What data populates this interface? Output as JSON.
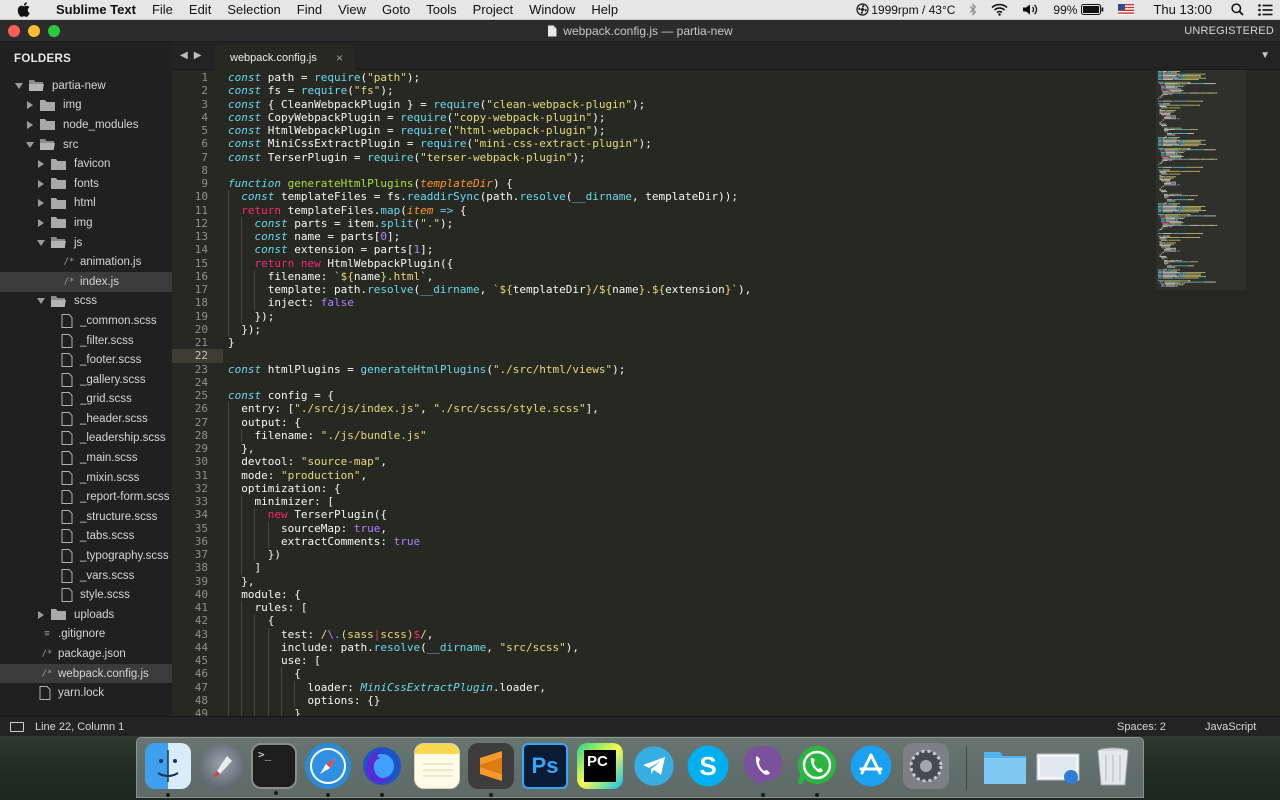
{
  "menubar": {
    "app": "Sublime Text",
    "items": [
      "File",
      "Edit",
      "Selection",
      "Find",
      "View",
      "Goto",
      "Tools",
      "Project",
      "Window",
      "Help"
    ],
    "status": "1999rpm / 43°C",
    "battery": "99%",
    "clock": "Thu 13:00"
  },
  "window": {
    "title": "webpack.config.js — partia-new",
    "unregistered": "UNREGISTERED"
  },
  "sidebar": {
    "header": "FOLDERS",
    "rows": [
      {
        "label": "partia-new",
        "kind": "folder",
        "depth": 0,
        "open": true
      },
      {
        "label": "img",
        "kind": "folder",
        "depth": 1,
        "open": false
      },
      {
        "label": "node_modules",
        "kind": "folder",
        "depth": 1,
        "open": false
      },
      {
        "label": "src",
        "kind": "folder",
        "depth": 1,
        "open": true
      },
      {
        "label": "favicon",
        "kind": "folder",
        "depth": 2,
        "open": false
      },
      {
        "label": "fonts",
        "kind": "folder",
        "depth": 2,
        "open": false
      },
      {
        "label": "html",
        "kind": "folder",
        "depth": 2,
        "open": false
      },
      {
        "label": "img",
        "kind": "folder",
        "depth": 2,
        "open": false
      },
      {
        "label": "js",
        "kind": "folder",
        "depth": 2,
        "open": true
      },
      {
        "label": "animation.js",
        "kind": "script",
        "depth": 3
      },
      {
        "label": "index.js",
        "kind": "script",
        "depth": 3,
        "selected": true
      },
      {
        "label": "scss",
        "kind": "folder",
        "depth": 2,
        "open": true
      },
      {
        "label": "_common.scss",
        "kind": "file",
        "depth": 3
      },
      {
        "label": "_filter.scss",
        "kind": "file",
        "depth": 3
      },
      {
        "label": "_footer.scss",
        "kind": "file",
        "depth": 3
      },
      {
        "label": "_gallery.scss",
        "kind": "file",
        "depth": 3
      },
      {
        "label": "_grid.scss",
        "kind": "file",
        "depth": 3
      },
      {
        "label": "_header.scss",
        "kind": "file",
        "depth": 3
      },
      {
        "label": "_leadership.scss",
        "kind": "file",
        "depth": 3
      },
      {
        "label": "_main.scss",
        "kind": "file",
        "depth": 3
      },
      {
        "label": "_mixin.scss",
        "kind": "file",
        "depth": 3
      },
      {
        "label": "_report-form.scss",
        "kind": "file",
        "depth": 3
      },
      {
        "label": "_structure.scss",
        "kind": "file",
        "depth": 3
      },
      {
        "label": "_tabs.scss",
        "kind": "file",
        "depth": 3
      },
      {
        "label": "_typography.scss",
        "kind": "file",
        "depth": 3
      },
      {
        "label": "_vars.scss",
        "kind": "file",
        "depth": 3
      },
      {
        "label": "style.scss",
        "kind": "file",
        "depth": 3
      },
      {
        "label": "uploads",
        "kind": "folder",
        "depth": 2,
        "open": false
      },
      {
        "label": ".gitignore",
        "kind": "text",
        "depth": 1
      },
      {
        "label": "package.json",
        "kind": "script",
        "depth": 1
      },
      {
        "label": "webpack.config.js",
        "kind": "script",
        "depth": 1,
        "selected": true
      },
      {
        "label": "yarn.lock",
        "kind": "file",
        "depth": 1
      }
    ]
  },
  "tab": {
    "label": "webpack.config.js",
    "close": "×"
  },
  "editor": {
    "current_line": 22,
    "colors": {
      "keyword": "#f92672",
      "storage": "#66d9ef",
      "string": "#e6db74",
      "function": "#a6e22e",
      "param": "#fd971f",
      "constant": "#ae81ff",
      "plain": "#f8f8f2"
    },
    "lines": [
      [
        [
          "const",
          "st"
        ],
        [
          " path = ",
          "p"
        ],
        [
          "require",
          "f"
        ],
        [
          "(",
          "p"
        ],
        [
          "\"path\"",
          "s"
        ],
        [
          ");",
          "p"
        ]
      ],
      [
        [
          "const",
          "st"
        ],
        [
          " fs = ",
          "p"
        ],
        [
          "require",
          "f"
        ],
        [
          "(",
          "p"
        ],
        [
          "\"fs\"",
          "s"
        ],
        [
          ");",
          "p"
        ]
      ],
      [
        [
          "const",
          "st"
        ],
        [
          " { CleanWebpackPlugin } = ",
          "p"
        ],
        [
          "require",
          "f"
        ],
        [
          "(",
          "p"
        ],
        [
          "\"clean-webpack-plugin\"",
          "s"
        ],
        [
          ");",
          "p"
        ]
      ],
      [
        [
          "const",
          "st"
        ],
        [
          " CopyWebpackPlugin = ",
          "p"
        ],
        [
          "require",
          "f"
        ],
        [
          "(",
          "p"
        ],
        [
          "\"copy-webpack-plugin\"",
          "s"
        ],
        [
          ");",
          "p"
        ]
      ],
      [
        [
          "const",
          "st"
        ],
        [
          " HtmlWebpackPlugin = ",
          "p"
        ],
        [
          "require",
          "f"
        ],
        [
          "(",
          "p"
        ],
        [
          "\"html-webpack-plugin\"",
          "s"
        ],
        [
          ");",
          "p"
        ]
      ],
      [
        [
          "const",
          "st"
        ],
        [
          " MiniCssExtractPlugin = ",
          "p"
        ],
        [
          "require",
          "f"
        ],
        [
          "(",
          "p"
        ],
        [
          "\"mini-css-extract-plugin\"",
          "s"
        ],
        [
          ");",
          "p"
        ]
      ],
      [
        [
          "const",
          "st"
        ],
        [
          " TerserPlugin = ",
          "p"
        ],
        [
          "require",
          "f"
        ],
        [
          "(",
          "p"
        ],
        [
          "\"terser-webpack-plugin\"",
          "s"
        ],
        [
          ");",
          "p"
        ]
      ],
      [],
      [
        [
          "function",
          "st"
        ],
        [
          " ",
          "p"
        ],
        [
          "generateHtmlPlugins",
          "fn"
        ],
        [
          "(",
          "p"
        ],
        [
          "templateDir",
          "pa"
        ],
        [
          ") {",
          "p"
        ]
      ],
      [
        [
          "  ",
          "p"
        ],
        [
          "const",
          "st"
        ],
        [
          " templateFiles = fs.",
          "p"
        ],
        [
          "readdirSync",
          "f"
        ],
        [
          "(path.",
          "p"
        ],
        [
          "resolve",
          "f"
        ],
        [
          "(",
          "p"
        ],
        [
          "__dirname",
          "f"
        ],
        [
          ", templateDir));",
          "p"
        ]
      ],
      [
        [
          "  ",
          "p"
        ],
        [
          "return",
          "k"
        ],
        [
          " templateFiles.",
          "p"
        ],
        [
          "map",
          "f"
        ],
        [
          "(",
          "p"
        ],
        [
          "item",
          "pa"
        ],
        [
          " ",
          "p"
        ],
        [
          "=>",
          "st"
        ],
        [
          " {",
          "p"
        ]
      ],
      [
        [
          "    ",
          "p"
        ],
        [
          "const",
          "st"
        ],
        [
          " parts = item.",
          "p"
        ],
        [
          "split",
          "f"
        ],
        [
          "(",
          "p"
        ],
        [
          "\".\"",
          "s"
        ],
        [
          ");",
          "p"
        ]
      ],
      [
        [
          "    ",
          "p"
        ],
        [
          "const",
          "st"
        ],
        [
          " name = parts[",
          "p"
        ],
        [
          "0",
          "c"
        ],
        [
          "];",
          "p"
        ]
      ],
      [
        [
          "    ",
          "p"
        ],
        [
          "const",
          "st"
        ],
        [
          " extension = parts[",
          "p"
        ],
        [
          "1",
          "c"
        ],
        [
          "];",
          "p"
        ]
      ],
      [
        [
          "    ",
          "p"
        ],
        [
          "return",
          "k"
        ],
        [
          " ",
          "p"
        ],
        [
          "new",
          "k"
        ],
        [
          " HtmlWebpackPlugin({",
          "p"
        ]
      ],
      [
        [
          "      filename: ",
          "p"
        ],
        [
          "`${",
          "s"
        ],
        [
          "name",
          "p"
        ],
        [
          "}.html`",
          "s"
        ],
        [
          ",",
          "p"
        ]
      ],
      [
        [
          "      template: path.",
          "p"
        ],
        [
          "resolve",
          "f"
        ],
        [
          "(",
          "p"
        ],
        [
          "__dirname",
          "f"
        ],
        [
          ", ",
          "p"
        ],
        [
          "`${",
          "s"
        ],
        [
          "templateDir",
          "p"
        ],
        [
          "}/${",
          "s"
        ],
        [
          "name",
          "p"
        ],
        [
          "}.${",
          "s"
        ],
        [
          "extension",
          "p"
        ],
        [
          "}`",
          "s"
        ],
        [
          "),",
          "p"
        ]
      ],
      [
        [
          "      inject: ",
          "p"
        ],
        [
          "false",
          "c"
        ]
      ],
      [
        [
          "    });",
          "p"
        ]
      ],
      [
        [
          "  });",
          "p"
        ]
      ],
      [
        [
          "}",
          "p"
        ]
      ],
      [],
      [
        [
          "const",
          "st"
        ],
        [
          " htmlPlugins = ",
          "p"
        ],
        [
          "generateHtmlPlugins",
          "f"
        ],
        [
          "(",
          "p"
        ],
        [
          "\"./src/html/views\"",
          "s"
        ],
        [
          ");",
          "p"
        ]
      ],
      [],
      [
        [
          "const",
          "st"
        ],
        [
          " config = {",
          "p"
        ]
      ],
      [
        [
          "  entry: [",
          "p"
        ],
        [
          "\"./src/js/index.js\"",
          "s"
        ],
        [
          ", ",
          "p"
        ],
        [
          "\"./src/scss/style.scss\"",
          "s"
        ],
        [
          "],",
          "p"
        ]
      ],
      [
        [
          "  output: {",
          "p"
        ]
      ],
      [
        [
          "    filename: ",
          "p"
        ],
        [
          "\"./js/bundle.js\"",
          "s"
        ]
      ],
      [
        [
          "  },",
          "p"
        ]
      ],
      [
        [
          "  devtool: ",
          "p"
        ],
        [
          "\"source-map\"",
          "s"
        ],
        [
          ",",
          "p"
        ]
      ],
      [
        [
          "  mode: ",
          "p"
        ],
        [
          "\"production\"",
          "s"
        ],
        [
          ",",
          "p"
        ]
      ],
      [
        [
          "  optimization: {",
          "p"
        ]
      ],
      [
        [
          "    minimizer: [",
          "p"
        ]
      ],
      [
        [
          "      ",
          "p"
        ],
        [
          "new",
          "k"
        ],
        [
          " TerserPlugin({",
          "p"
        ]
      ],
      [
        [
          "        sourceMap: ",
          "p"
        ],
        [
          "true",
          "c"
        ],
        [
          ",",
          "p"
        ]
      ],
      [
        [
          "        extractComments: ",
          "p"
        ],
        [
          "true",
          "c"
        ]
      ],
      [
        [
          "      })",
          "p"
        ]
      ],
      [
        [
          "    ]",
          "p"
        ]
      ],
      [
        [
          "  },",
          "p"
        ]
      ],
      [
        [
          "  module: {",
          "p"
        ]
      ],
      [
        [
          "    rules: [",
          "p"
        ]
      ],
      [
        [
          "      {",
          "p"
        ]
      ],
      [
        [
          "        test: ",
          "p"
        ],
        [
          "/",
          "s"
        ],
        [
          "\\.",
          "c"
        ],
        [
          "(",
          "s"
        ],
        [
          "sass",
          "s"
        ],
        [
          "|",
          "k"
        ],
        [
          "scss",
          "s"
        ],
        [
          ")",
          "s"
        ],
        [
          "$",
          "k"
        ],
        [
          "/",
          "s"
        ],
        [
          ",",
          "p"
        ]
      ],
      [
        [
          "        include: path.",
          "p"
        ],
        [
          "resolve",
          "f"
        ],
        [
          "(",
          "p"
        ],
        [
          "__dirname",
          "f"
        ],
        [
          ", ",
          "p"
        ],
        [
          "\"src/scss\"",
          "s"
        ],
        [
          "),",
          "p"
        ]
      ],
      [
        [
          "        use: [",
          "p"
        ]
      ],
      [
        [
          "          {",
          "p"
        ]
      ],
      [
        [
          "            loader: ",
          "p"
        ],
        [
          "MiniCssExtractPlugin",
          "it"
        ],
        [
          ".loader,",
          "p"
        ]
      ],
      [
        [
          "            options: {}",
          "p"
        ]
      ],
      [
        [
          "          }",
          "p"
        ]
      ]
    ]
  },
  "status": {
    "position": "Line 22, Column 1",
    "spaces": "Spaces: 2",
    "syntax": "JavaScript"
  },
  "dock": {
    "apps": [
      "finder-icon",
      "launchpad-icon",
      "terminal-icon",
      "safari-icon",
      "firefox-icon",
      "notes-icon",
      "sublime-icon",
      "photoshop-icon",
      "pycharm-icon",
      "telegram-icon",
      "skype-icon",
      "viber-icon",
      "whatsapp-icon",
      "app-store-icon",
      "system-preferences-icon",
      "downloads-folder-icon",
      "preview-icon",
      "trash-icon"
    ],
    "labels": {
      "photoshop": "Ps",
      "pycharm": "PC",
      "skype": "S",
      "terminal": ">_"
    }
  }
}
